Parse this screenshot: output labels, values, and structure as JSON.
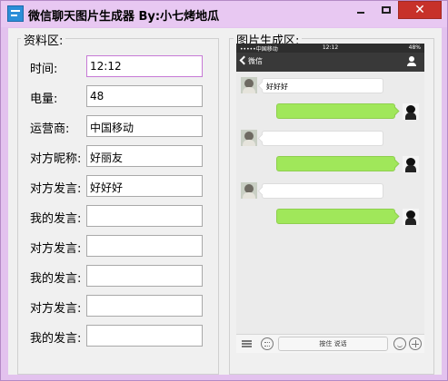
{
  "window": {
    "title": "微信聊天图片生成器 By:小七烤地瓜",
    "close_glyph": "✕"
  },
  "info_panel": {
    "title": "资料区:",
    "fields": [
      {
        "label": "时间:",
        "value": "12:12"
      },
      {
        "label": "电量:",
        "value": "48"
      },
      {
        "label": "运营商:",
        "value": "中国移动"
      },
      {
        "label": "对方昵称:",
        "value": "好丽友"
      },
      {
        "label": "对方发言:",
        "value": "好好好"
      },
      {
        "label": "我的发言:",
        "value": ""
      },
      {
        "label": "对方发言:",
        "value": ""
      },
      {
        "label": "我的发言:",
        "value": ""
      },
      {
        "label": "对方发言:",
        "value": ""
      },
      {
        "label": "我的发言:",
        "value": ""
      }
    ]
  },
  "preview_panel": {
    "title": "图片生成区:",
    "status_bar": {
      "carrier": "•••••中国移动",
      "time": "12:12",
      "battery": "48%"
    },
    "nav": {
      "back_label": "微信"
    },
    "messages": [
      {
        "side": "left",
        "text": "好好好"
      },
      {
        "side": "right",
        "text": ""
      },
      {
        "side": "left",
        "text": ""
      },
      {
        "side": "right",
        "text": ""
      },
      {
        "side": "left",
        "text": ""
      },
      {
        "side": "right",
        "text": ""
      }
    ],
    "input_bar": {
      "talk_label": "按住 说话"
    }
  }
}
